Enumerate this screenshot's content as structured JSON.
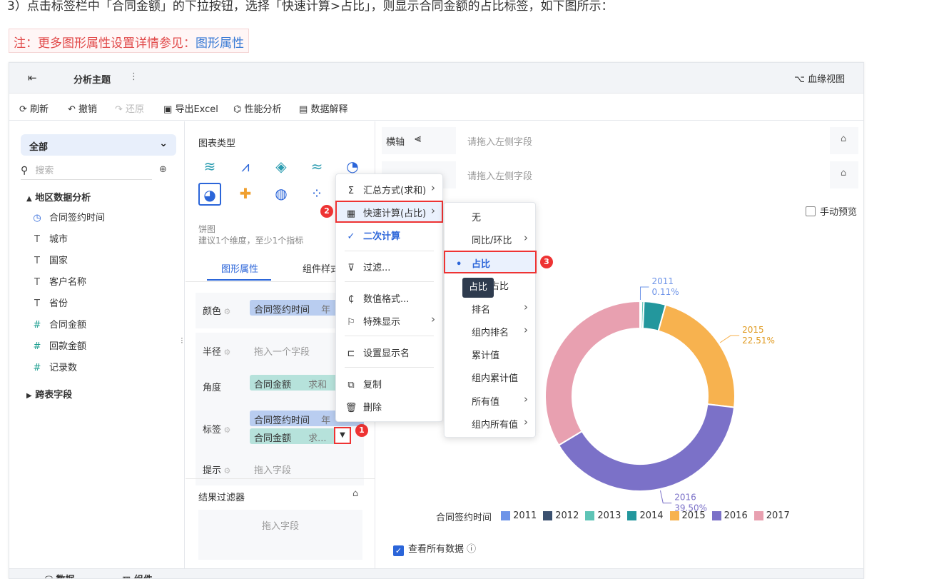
{
  "doc": {
    "instruction": "3）点击标签栏中「合同金额」的下拉按钮，选择「快速计算>占比」，则显示合同金额的占比标签，如下图所示：",
    "note_prefix": "注：更多图形属性设置详情参见：",
    "note_link": "图形属性"
  },
  "topbar": {
    "title": "分析主题",
    "lineage": "血缘视图"
  },
  "toolbar": {
    "refresh": "刷新",
    "undo": "撤销",
    "redo": "还原",
    "export": "导出Excel",
    "perf": "性能分析",
    "explain": "数据解释"
  },
  "left": {
    "scope": "全部",
    "search_placeholder": "搜索",
    "group": "地区数据分析",
    "fields": [
      {
        "icon": "clock-icon",
        "glyph": "◷",
        "label": "合同签约时间"
      },
      {
        "icon": "text-icon",
        "glyph": "T",
        "label": "城市"
      },
      {
        "icon": "text-icon",
        "glyph": "T",
        "label": "国家"
      },
      {
        "icon": "text-icon",
        "glyph": "T",
        "label": "客户名称"
      },
      {
        "icon": "text-icon",
        "glyph": "T",
        "label": "省份"
      },
      {
        "icon": "number-icon",
        "glyph": "#",
        "label": "合同金额"
      },
      {
        "icon": "number-icon",
        "glyph": "#",
        "label": "回款金额"
      },
      {
        "icon": "record-count-icon",
        "glyph": "#",
        "label": "记录数"
      }
    ],
    "crosstable": "跨表字段"
  },
  "mid": {
    "chart_type_title": "图表类型",
    "pie_name": "饼图",
    "pie_hint": "建议1个维度，至少1个指标",
    "tab_graph": "图形属性",
    "tab_component": "组件样式",
    "rows": {
      "color": "颜色",
      "radius": "半径",
      "angle": "角度",
      "label": "标签",
      "tooltip": "提示"
    },
    "chips": {
      "color_field": "合同签约时间",
      "color_suffix": "年",
      "radius_placeholder": "拖入一个字段",
      "angle_field": "合同金额",
      "angle_suffix": "求和",
      "label_field1": "合同签约时间",
      "label_suffix1": "年",
      "label_field2": "合同金额",
      "label_suffix2": "求...",
      "tooltip_placeholder": "拖入字段"
    },
    "result_filter": "结果过滤器",
    "drop_placeholder": "拖入字段"
  },
  "right": {
    "x_axis": "横轴",
    "x_placeholder": "请拖入左侧字段",
    "y_placeholder": "请拖入左侧字段",
    "manual_preview": "手动预览",
    "view_all": "查看所有数据",
    "legend_title": "合同签约时间"
  },
  "menu1": {
    "items": [
      "汇总方式(求和)",
      "快速计算(占比)",
      "二次计算",
      "过滤...",
      "数值格式...",
      "特殊显示",
      "设置显示名",
      "复制",
      "删除"
    ]
  },
  "menu2": {
    "items": [
      "无",
      "同比/环比",
      "占比",
      "组内占比",
      "排名",
      "组内排名",
      "累计值",
      "组内累计值",
      "所有值",
      "组内所有值"
    ],
    "tooltip": "占比"
  },
  "badges": [
    "1",
    "2",
    "3"
  ],
  "bottom": {
    "data_tab": "数据",
    "component_tab": "组件"
  },
  "chart_data": {
    "type": "pie",
    "donut": true,
    "categories": [
      "2011",
      "2012",
      "2013",
      "2014",
      "2015",
      "2016",
      "2017"
    ],
    "values": [
      0.11,
      0.15,
      0.4,
      3.7,
      22.51,
      39.5,
      33.63
    ],
    "colors": [
      "#6e94e8",
      "#3b5170",
      "#5ec4b6",
      "#23979d",
      "#f7b24f",
      "#7b71c8",
      "#e8a0b0"
    ],
    "labels_shown": [
      {
        "category": "2011",
        "text": "0.11%"
      },
      {
        "category": "2015",
        "text": "22.51%"
      },
      {
        "category": "2016",
        "text": "39.50%"
      }
    ],
    "legend_position": "bottom"
  }
}
